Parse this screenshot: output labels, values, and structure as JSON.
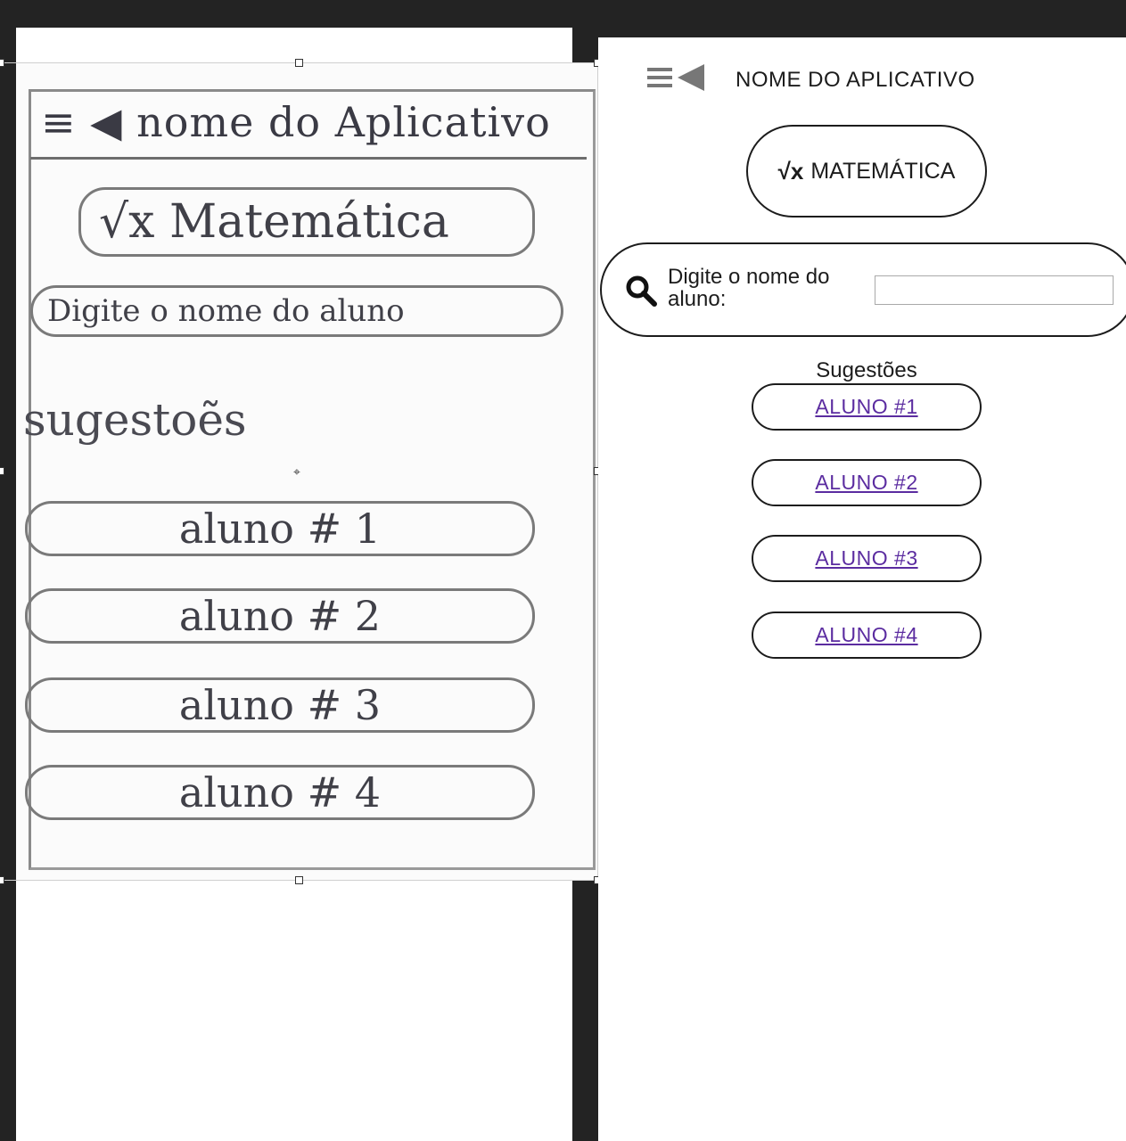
{
  "sketch": {
    "header": "≡ ◀ nome do Aplicativo",
    "math": "√x Matemática",
    "search": "Digite o nome do aluno",
    "suggestions": "sugestoẽs",
    "alunos": [
      "aluno # 1",
      "aluno # 2",
      "aluno # 3",
      "aluno # 4"
    ]
  },
  "app": {
    "title": "NOME DO APLICATIVO",
    "math_button": {
      "icon": "√x",
      "label": "MATEMÁTICA"
    },
    "search": {
      "label": "Digite o nome do aluno:",
      "value": "",
      "placeholder": ""
    },
    "suggestions_title": "Sugestões",
    "alunos": [
      "ALUNO #1",
      "ALUNO #2",
      "ALUNO #3",
      "ALUNO #4"
    ]
  },
  "colors": {
    "link": "#5b2ca0",
    "workspace": "#232323",
    "ink": "#1c1c1c"
  }
}
